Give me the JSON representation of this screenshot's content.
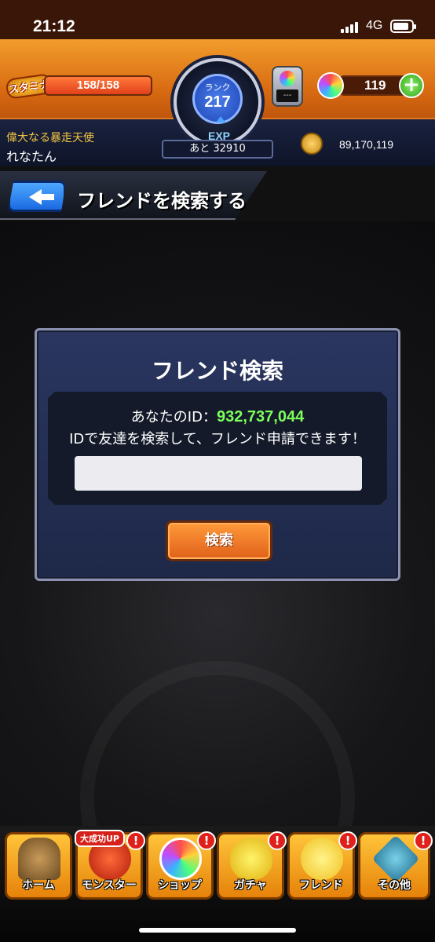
{
  "status_bar": {
    "time": "21:12",
    "network": "4G"
  },
  "header": {
    "stamina_label": "スタミナ",
    "stamina_text": "158/158",
    "stamina_fraction": 1.0,
    "rank_label": "ランク",
    "rank_value": "217",
    "exp_label": "EXP",
    "exp_remaining": "あと 32910",
    "user_title": "偉大なる暴走天使",
    "user_name": "れなたん",
    "device_screen": "---",
    "orb_count": "119",
    "add_orb_label": "+",
    "coin_count": "89,170,119"
  },
  "title_bar": {
    "title": "フレンドを検索する"
  },
  "dialog": {
    "title": "フレンド検索",
    "id_prefix": "あなたのID：",
    "id_value": "932,737,044",
    "help_text": "IDで友達を検索して、フレンド申請できます！",
    "input_value": "",
    "search_button": "検索"
  },
  "bottom_nav": {
    "items": [
      {
        "label": "ホーム",
        "icon": "home-icon"
      },
      {
        "label": "モンスター",
        "icon": "monster-icon",
        "badge": "大成功UP",
        "alert": "!"
      },
      {
        "label": "ショップ",
        "icon": "shop-orb-icon",
        "alert": "!"
      },
      {
        "label": "ガチャ",
        "icon": "gacha-egg-icon",
        "alert": "!"
      },
      {
        "label": "フレンド",
        "icon": "friend-icon",
        "alert": "!"
      },
      {
        "label": "その他",
        "icon": "other-icon",
        "alert": "!"
      }
    ]
  },
  "colors": {
    "header_orange": "#e07a1d",
    "id_green": "#7dff5a",
    "dialog_blue": "#2a3660",
    "button_orange": "#f07a2a",
    "alert_red": "#e0201a"
  }
}
